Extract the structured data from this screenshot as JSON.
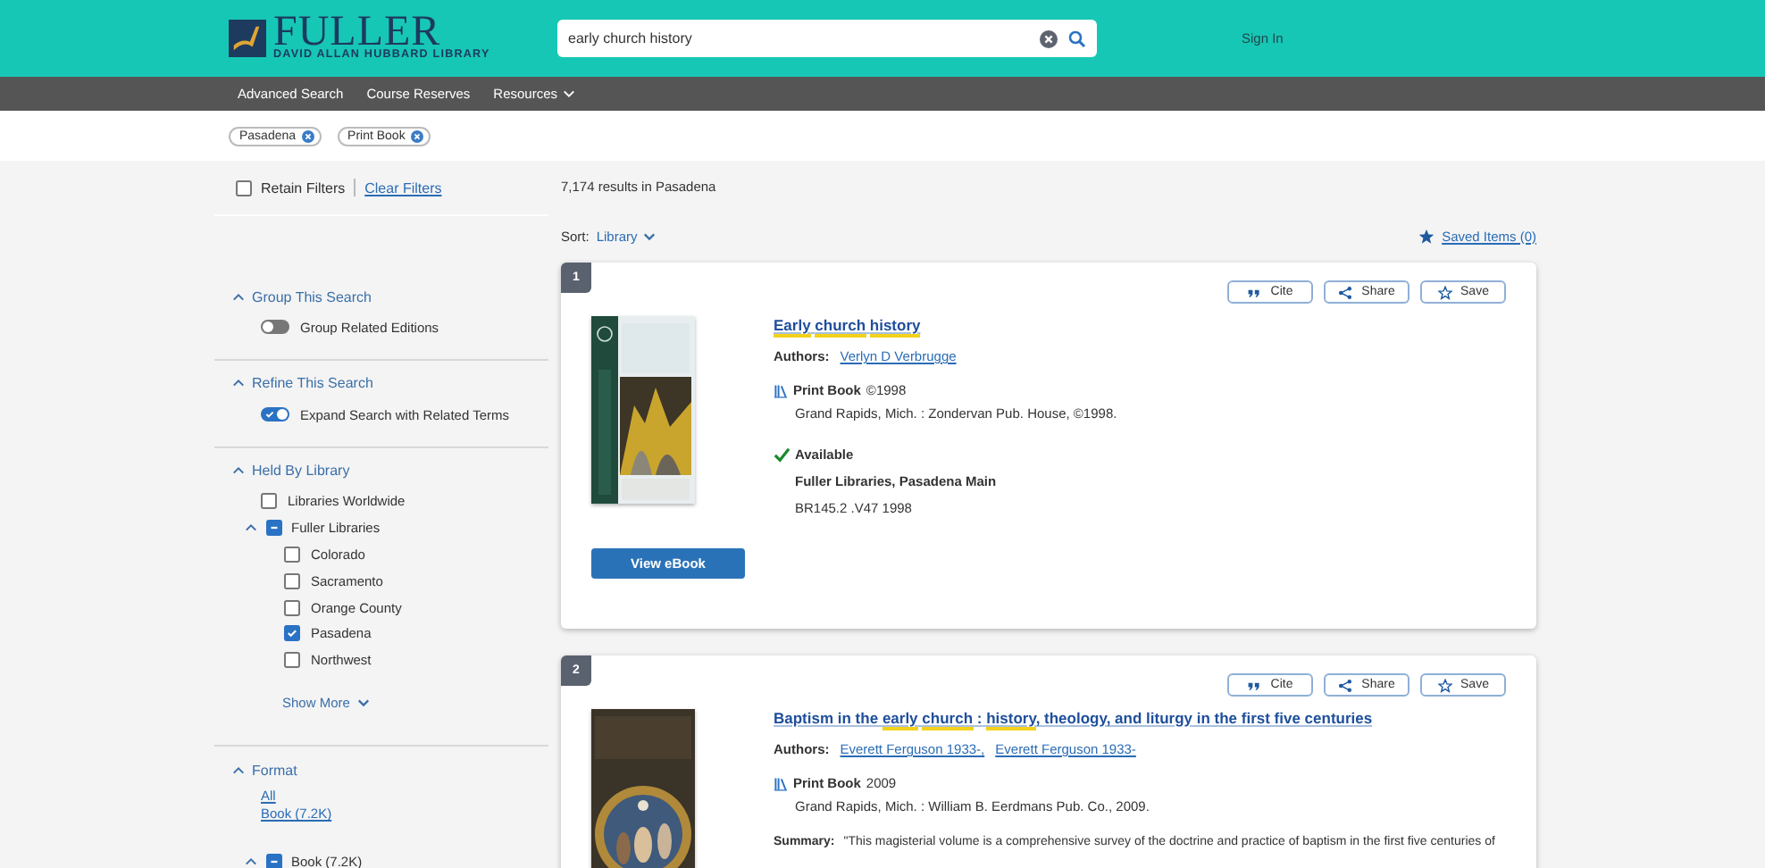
{
  "header": {
    "logo": {
      "title": "FULLER",
      "subtitle": "DAVID ALLAN HUBBARD LIBRARY"
    },
    "search": {
      "value": "early church history"
    },
    "sign_in": "Sign In"
  },
  "nav": [
    {
      "label": "Advanced Search",
      "dropdown": false
    },
    {
      "label": "Course Reserves",
      "dropdown": false
    },
    {
      "label": "Resources",
      "dropdown": true
    }
  ],
  "applied_filters": [
    "Pasadena",
    "Print Book"
  ],
  "retain_filters": {
    "label": "Retain Filters",
    "checked": false
  },
  "clear_filters": "Clear Filters",
  "results_count": "7,174 results in Pasadena",
  "sort": {
    "label": "Sort:",
    "value": "Library"
  },
  "saved_items": "Saved Items (0)",
  "facets": [
    {
      "title": "Group This Search",
      "expanded": true,
      "items": [
        {
          "kind": "toggle",
          "label": "Group Related Editions",
          "on": false
        }
      ]
    },
    {
      "title": "Refine This Search",
      "expanded": true,
      "items": [
        {
          "kind": "toggle",
          "label": "Expand Search with Related Terms",
          "on": true
        }
      ]
    },
    {
      "title": "Held By Library",
      "expanded": true,
      "items": [
        {
          "kind": "checkbox",
          "label": "Libraries Worldwide",
          "checked": false
        },
        {
          "kind": "checkbox",
          "label": "Fuller Libraries",
          "partial": true,
          "expanded": true,
          "children": [
            {
              "kind": "checkbox",
              "label": "Colorado",
              "checked": false
            },
            {
              "kind": "checkbox",
              "label": "Sacramento",
              "checked": false
            },
            {
              "kind": "checkbox",
              "label": "Orange County",
              "checked": false
            },
            {
              "kind": "checkbox",
              "label": "Pasadena",
              "checked": true
            },
            {
              "kind": "checkbox",
              "label": "Northwest",
              "checked": false
            }
          ]
        }
      ],
      "show_more": "Show More"
    },
    {
      "title": "Format",
      "expanded": true,
      "items": [
        {
          "kind": "link",
          "label": "All"
        },
        {
          "kind": "link",
          "label": "Book (7.2K)"
        },
        {
          "kind": "checkbox",
          "label": "Book (7.2K)",
          "partial": true,
          "expanded": true
        }
      ]
    }
  ],
  "results": [
    {
      "number": "1",
      "actions": [
        "Cite",
        "Share",
        "Save"
      ],
      "title": [
        {
          "text": "Early ",
          "highlight": true
        },
        {
          "text": "church ",
          "highlight": true
        },
        {
          "text": "history",
          "highlight": true
        }
      ],
      "authors_label": "Authors:",
      "authors": [
        "Verlyn D Verbrugge"
      ],
      "format": "Print Book",
      "year": "©1998",
      "publisher": "Grand Rapids, Mich. : Zondervan Pub. House, ©1998.",
      "availability": {
        "status": "Available",
        "location": "Fuller Libraries, Pasadena Main",
        "call_number": "BR145.2 .V47 1998"
      },
      "button": "View eBook"
    },
    {
      "number": "2",
      "actions": [
        "Cite",
        "Share",
        "Save"
      ],
      "title": [
        {
          "text": "Baptism in the ",
          "highlight": false
        },
        {
          "text": "early ",
          "highlight": true
        },
        {
          "text": "church",
          "highlight": true
        },
        {
          "text": " : ",
          "highlight": false
        },
        {
          "text": "history",
          "highlight": true
        },
        {
          "text": ", theology, and liturgy in the first five centuries",
          "highlight": false
        }
      ],
      "authors_label": "Authors:",
      "authors": [
        "Everett Ferguson 1933-,",
        "Everett Ferguson 1933-"
      ],
      "format": "Print Book",
      "year": "2009",
      "publisher": "Grand Rapids, Mich. : William B. Eerdmans Pub. Co., 2009.",
      "summary": {
        "label": "Summary:",
        "text": "\"This magisterial volume is a comprehensive survey of the doctrine and practice of baptism in the first five centuries of"
      }
    }
  ]
}
